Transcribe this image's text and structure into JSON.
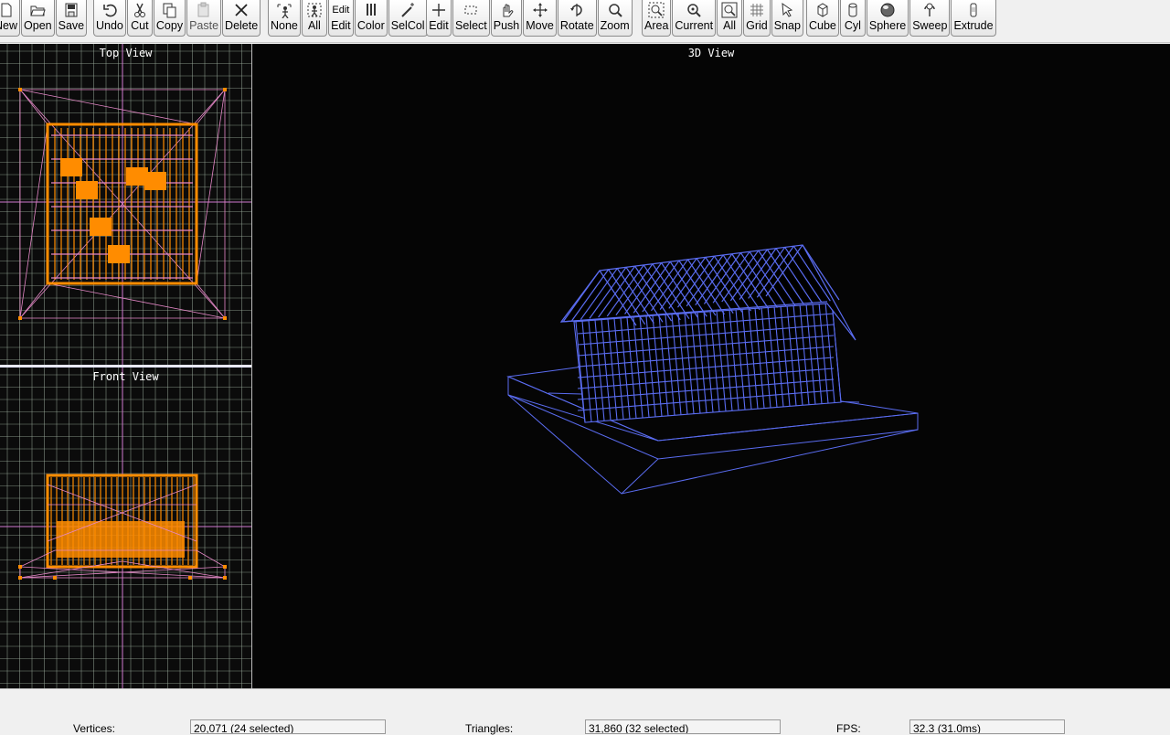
{
  "toolbar": {
    "groups": [
      {
        "buttons": [
          {
            "label": "New",
            "icon": "new-file-icon"
          },
          {
            "label": "Open",
            "icon": "open-folder-icon"
          },
          {
            "label": "Save",
            "icon": "save-disk-icon"
          }
        ]
      },
      {
        "buttons": [
          {
            "label": "Undo",
            "icon": "undo-icon"
          },
          {
            "label": "Cut",
            "icon": "scissors-icon"
          },
          {
            "label": "Copy",
            "icon": "copy-icon"
          },
          {
            "label": "Paste",
            "icon": "paste-icon",
            "disabled": true
          },
          {
            "label": "Delete",
            "icon": "delete-x-icon"
          }
        ]
      },
      {
        "buttons": [
          {
            "label": "None",
            "icon": "select-none-icon"
          },
          {
            "label": "All",
            "icon": "select-all-icon"
          },
          {
            "label": "Edit",
            "icon": "edit-selection-icon",
            "icon_text": "Edit"
          },
          {
            "label": "Color",
            "icon": "color-bars-icon"
          },
          {
            "label": "SelCol",
            "icon": "magic-wand-icon"
          }
        ]
      },
      {
        "buttons": [
          {
            "label": "Edit",
            "icon": "crosshair-icon"
          },
          {
            "label": "Select",
            "icon": "select-rectangle-icon"
          },
          {
            "label": "Push",
            "icon": "hand-push-icon"
          },
          {
            "label": "Move",
            "icon": "move-arrows-icon"
          },
          {
            "label": "Rotate",
            "icon": "rotate-icon"
          },
          {
            "label": "Zoom",
            "icon": "magnifier-icon"
          }
        ]
      },
      {
        "buttons": [
          {
            "label": "Area",
            "icon": "zoom-area-icon"
          },
          {
            "label": "Current",
            "icon": "zoom-current-icon"
          },
          {
            "label": "All",
            "icon": "zoom-all-icon"
          },
          {
            "label": "Grid",
            "icon": "grid-icon"
          },
          {
            "label": "Snap",
            "icon": "snap-cursor-icon"
          }
        ]
      },
      {
        "buttons": [
          {
            "label": "Cube",
            "icon": "cube-icon"
          },
          {
            "label": "Cyl",
            "icon": "cylinder-icon"
          },
          {
            "label": "Sphere",
            "icon": "sphere-icon"
          },
          {
            "label": "Sweep",
            "icon": "sweep-icon"
          },
          {
            "label": "Extrude",
            "icon": "extrude-icon"
          }
        ]
      }
    ]
  },
  "views": {
    "top": {
      "title": "Top View"
    },
    "front": {
      "title": "Front View"
    },
    "main": {
      "title": "3D View"
    }
  },
  "status": {
    "vertices_label": "Vertices:",
    "vertices_value": "20,071   (24 selected)",
    "triangles_label": "Triangles:",
    "triangles_value": "31,860   (32 selected)",
    "fps_label": "FPS:",
    "fps_value": "32.3 (31.0ms)"
  },
  "colors": {
    "grid_line": "#9fb0a0",
    "grid_axis": "#d07ad0",
    "wire_pink": "#e688c8",
    "vertex_orange": "#ff8c00",
    "wire_blue": "#5a6cf0",
    "viewport_bg": "#0b0b0b"
  }
}
